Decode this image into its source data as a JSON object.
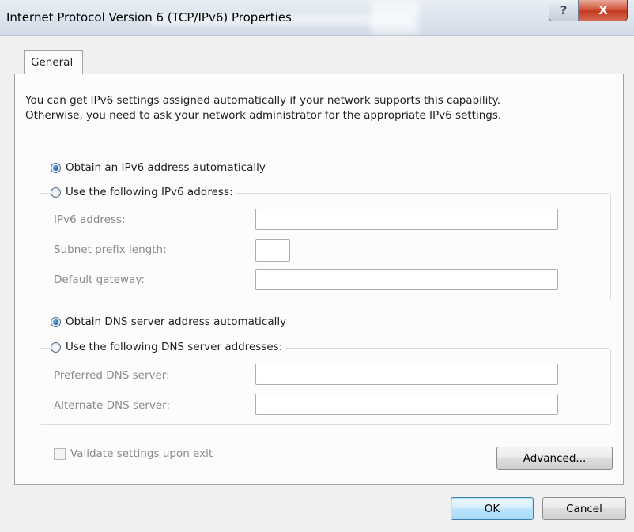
{
  "window": {
    "title": "Internet Protocol Version 6 (TCP/IPv6) Properties"
  },
  "titlebar": {
    "help_glyph": "?",
    "close_glyph": "X"
  },
  "tabs": [
    {
      "label": "General"
    }
  ],
  "description": {
    "line1": "You can get IPv6 settings assigned automatically if your network supports this capability.",
    "line2": "Otherwise, you need to ask your network administrator for the appropriate IPv6 settings."
  },
  "ip": {
    "auto_label": "Obtain an IPv6 address automatically",
    "manual_label": "Use the following IPv6 address:",
    "selected": "auto",
    "address_label": "IPv6 address:",
    "address_value": "",
    "prefix_label": "Subnet prefix length:",
    "prefix_value": "",
    "gateway_label": "Default gateway:",
    "gateway_value": ""
  },
  "dns": {
    "auto_label": "Obtain DNS server address automatically",
    "manual_label": "Use the following DNS server addresses:",
    "selected": "auto",
    "preferred_label": "Preferred DNS server:",
    "preferred_value": "",
    "alternate_label": "Alternate DNS server:",
    "alternate_value": ""
  },
  "validate": {
    "label": "Validate settings upon exit",
    "checked": false
  },
  "buttons": {
    "advanced": "Advanced...",
    "ok": "OK",
    "cancel": "Cancel"
  },
  "colors": {
    "accent_blue": "#1c5fa8",
    "close_red": "#c43a21",
    "disabled_text": "#8a8a8a"
  }
}
